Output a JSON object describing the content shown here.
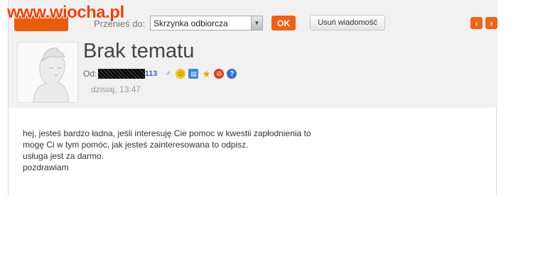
{
  "watermark": "www.wiocha.pl",
  "toolbar": {
    "move_label": "Przenieś do:",
    "folder_selected": "Skrzynka odbiorcza",
    "ok_label": "OK",
    "delete_label": "Usuń wiadomość",
    "prev_label": "‹",
    "next_label": "›"
  },
  "message": {
    "subject": "Brak tematu",
    "from_label": "Od:",
    "sender_suffix": "113",
    "date": "dzisiaj, 13:47",
    "body_lines": [
      "hej, jesteś bardzo ładna, jeśli interesuję Cie pomoc w kwestii zapłodnienia to",
      "mogę Ci w tym pomóc, jak jesteś zainteresowana to odpisz.",
      "usługa jest za darmo.",
      "pozdrawiam"
    ]
  },
  "icons": {
    "sender_actions": [
      "gender-icon",
      "smiley-icon",
      "profile-book-icon",
      "favorite-star-icon",
      "block-icon",
      "help-icon"
    ]
  },
  "colors": {
    "accent": "#ee6012",
    "link": "#2d6fb7",
    "header_bg": "#f1f1f1"
  }
}
